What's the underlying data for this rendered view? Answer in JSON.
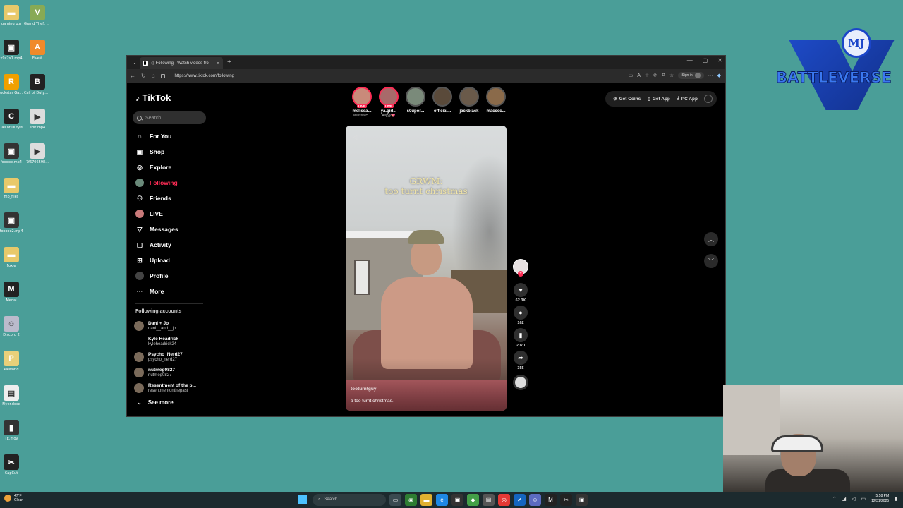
{
  "desktop": {
    "icons_left": [
      {
        "label": "gaming p.p",
        "color": "#e8c96a",
        "glyph": "▬"
      },
      {
        "label": "x9x2x1.mp4",
        "color": "#222222",
        "glyph": "▣"
      },
      {
        "label": "Rockstar Games ...",
        "color": "#f0a000",
        "glyph": "R"
      },
      {
        "label": "Call of Duty®",
        "color": "#222222",
        "glyph": "C"
      },
      {
        "label": "fooooe.mp4",
        "color": "#333333",
        "glyph": "▣"
      },
      {
        "label": "mp_files",
        "color": "#e8c96a",
        "glyph": "▬"
      },
      {
        "label": "fooooe2.mp4",
        "color": "#333333",
        "glyph": "▣"
      },
      {
        "label": "Foxie",
        "color": "#e8c96a",
        "glyph": "▬"
      },
      {
        "label": "Medal",
        "color": "#222222",
        "glyph": "M"
      },
      {
        "label": "Discord 2",
        "color": "#bbbbcc",
        "glyph": "☺"
      },
      {
        "label": "Palworld",
        "color": "#e8d07a",
        "glyph": "P"
      },
      {
        "label": "Flyer.docx",
        "color": "#eeeeee",
        "glyph": "▤"
      },
      {
        "label": "TE.mov",
        "color": "#333333",
        "glyph": "▮"
      },
      {
        "label": "CapCut",
        "color": "#222222",
        "glyph": "✂"
      }
    ],
    "icons_right": [
      {
        "label": "Grand Theft Auto V Ek...",
        "color": "#88aa55",
        "glyph": "V"
      },
      {
        "label": "FiveM",
        "color": "#f08a2a",
        "glyph": "A"
      },
      {
        "label": "Call of Duty® Bla...",
        "color": "#222222",
        "glyph": "B"
      },
      {
        "label": "edit.mp4",
        "color": "#dddddd",
        "glyph": "▶"
      },
      {
        "label": "7f6706598...",
        "color": "#dddddd",
        "glyph": "▶"
      }
    ]
  },
  "browser": {
    "tab_title": "Following - Watch videos fro",
    "url": "https://www.tiktok.com/following",
    "sign_in": "Sign in"
  },
  "tiktok": {
    "logo": "TikTok",
    "search_placeholder": "Search",
    "nav": [
      {
        "label": "For You",
        "icon": "home-icon",
        "glyph": "⌂",
        "active": false
      },
      {
        "label": "Shop",
        "icon": "shop-icon",
        "glyph": "▣",
        "active": false
      },
      {
        "label": "Explore",
        "icon": "compass-icon",
        "glyph": "◎",
        "active": false
      },
      {
        "label": "Following",
        "icon": "following-icon",
        "glyph": "",
        "active": true
      },
      {
        "label": "Friends",
        "icon": "friends-icon",
        "glyph": "⚇",
        "active": false
      },
      {
        "label": "LIVE",
        "icon": "live-icon",
        "glyph": "",
        "active": false
      },
      {
        "label": "Messages",
        "icon": "messages-icon",
        "glyph": "▽",
        "active": false
      },
      {
        "label": "Activity",
        "icon": "activity-icon",
        "glyph": "▢",
        "active": false
      },
      {
        "label": "Upload",
        "icon": "upload-icon",
        "glyph": "⊞",
        "active": false
      },
      {
        "label": "Profile",
        "icon": "profile-icon",
        "glyph": "",
        "active": false
      },
      {
        "label": "More",
        "icon": "more-icon",
        "glyph": "···",
        "active": false
      }
    ],
    "following_title": "Following accounts",
    "following_accounts": [
      {
        "name": "Dani + Jo",
        "handle": "dani__and__jo",
        "has_avatar": true
      },
      {
        "name": "Kyle Headrick",
        "handle": "kyleheadrick24",
        "has_avatar": false
      },
      {
        "name": "Psycho_Nerd27",
        "handle": "psycho_nerd27",
        "has_avatar": true
      },
      {
        "name": "nutmeg0827",
        "handle": "nutmeg0827",
        "has_avatar": true
      },
      {
        "name": "Resentment of the p...",
        "handle": "resentmentonthepast",
        "has_avatar": true
      }
    ],
    "see_more": "See more",
    "stories": [
      {
        "name": "melissa...",
        "sub": "Melissa H...",
        "live": true
      },
      {
        "name": "ya.girl...",
        "sub": "Allyyy💖",
        "live": true
      },
      {
        "name": "s0upor...",
        "sub": "",
        "live": false
      },
      {
        "name": "official...",
        "sub": "",
        "live": false
      },
      {
        "name": "jackblack",
        "sub": "",
        "live": false
      },
      {
        "name": "macccc...",
        "sub": "",
        "live": false
      }
    ],
    "live_badge": "LIVE",
    "top_buttons": {
      "coins": "Get Coins",
      "app": "Get App",
      "pc": "PC App"
    },
    "video": {
      "overlay_line1": "GRWM:",
      "overlay_line2": "too turnt christmas",
      "user": "tooturntguy",
      "description": "a too turnt christmas."
    },
    "actions": {
      "likes": "62.3K",
      "comments": "162",
      "saves": "2070",
      "shares": "355"
    }
  },
  "watermark": {
    "monogram": "MJ",
    "text": "BATTLEVERSE"
  },
  "taskbar": {
    "temp": "47°F",
    "weather": "Clear",
    "search": "Search",
    "time": "5:58 PM",
    "date": "12/31/2025"
  }
}
